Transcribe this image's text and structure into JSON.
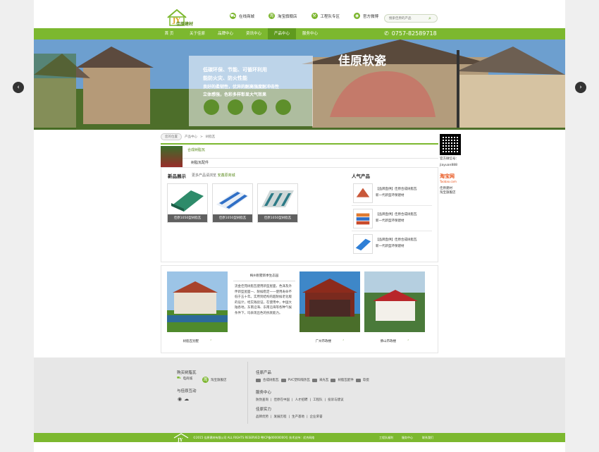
{
  "header": {
    "brand": "佳原建材",
    "links": [
      {
        "label": "在线商城",
        "icon": "cart-icon"
      },
      {
        "label": "淘宝旗舰店",
        "icon": "taobao-icon"
      },
      {
        "label": "工程队专区",
        "icon": "worker-icon"
      },
      {
        "label": "官方微博",
        "icon": "weibo-icon"
      }
    ],
    "search_placeholder": "搜索佳原的产品"
  },
  "nav": {
    "items": [
      "首 页",
      "关于佳原",
      "品牌中心",
      "资讯中心",
      "产品中心",
      "服务中心"
    ],
    "active": "产品中心",
    "phone": "0757-82589718"
  },
  "banner": {
    "headline": "佳原软瓷",
    "lines": [
      "低碳环保、节能、可循环利用",
      "能防火灾、防火性能",
      "良好的柔韧性，优异的耐高强度耐冲击性",
      "立体感强，色彩多样彰显大气效果"
    ]
  },
  "breadcrumb": {
    "home": "您的位置",
    "items": [
      "产品中心",
      "树脂瓦"
    ]
  },
  "category": {
    "title": "合成树脂瓦",
    "sub": "树脂瓦配件"
  },
  "new_products": {
    "title": "新品展示",
    "more": "更多产品请浏览",
    "mall": "安鑫原商城",
    "items": [
      "佳原1050型树脂瓦",
      "佳原1050型树脂瓦",
      "佳原1050型树脂瓦"
    ]
  },
  "hot_products": {
    "title": "人气产品",
    "items": [
      {
        "line1": "【品牌直供】佳原合成树脂瓦",
        "line2": "新一代新型环保建材"
      },
      {
        "line1": "【品牌直供】佳原合成树脂瓦",
        "line2": "新一代新型环保建材"
      },
      {
        "line1": "【品牌直供】佳原合成树脂瓦",
        "line2": "新一代新型环保建材"
      }
    ]
  },
  "cases": {
    "left_caption": "树脂瓦别墅",
    "mid_caption": "广州市政楼",
    "right_caption": "佛山市政楼",
    "story_title": "梅州别墅新季生态园",
    "story": "流金佳苑树脂瓦使用新型屋面，色泽及外伴新型屋面一、耐候稳定一一使用寿命不低于五十年。实用到结构的超耐候老化版的设计，经实践验证，在使用中，中国大陆各地，东南沿海、东南沿海等各种气候条件下，均表现出色的抗衰能力。"
  },
  "side": {
    "qr_label": "官方微信号：",
    "qr_id": "jiayuan888",
    "taobao": "淘宝网",
    "taobao_url": "Taobao.com",
    "taobao_caption1": "佳原建材",
    "taobao_caption2": "淘宝旗舰店"
  },
  "footer": {
    "buy_title": "购买树脂瓦",
    "buy_links": [
      "电商城",
      "淘宝旗舰店"
    ],
    "interact_title": "与佳原互动",
    "products_title": "佳原产品",
    "products": [
      "合成树脂瓦",
      "PVC塑料隔热瓦",
      "采光瓦",
      "树脂瓦配件",
      "软瓷"
    ],
    "service_title": "服务中心",
    "service": [
      "防伪查询",
      "佳原在中国",
      "人才招聘",
      "工程队",
      "投诉与建议"
    ],
    "strength_title": "佳原实力",
    "strength": [
      "品牌优势",
      "发展历程",
      "生产基地",
      "企业荣誉"
    ]
  },
  "bottom": {
    "copyright": "©2015 佳原建材有限公司 ALL RIGHTS RESERVED 粤ICP备00000000号 技术支持：优杰网络",
    "links": [
      "工程队福利",
      "服务中心",
      "联系我们"
    ]
  }
}
